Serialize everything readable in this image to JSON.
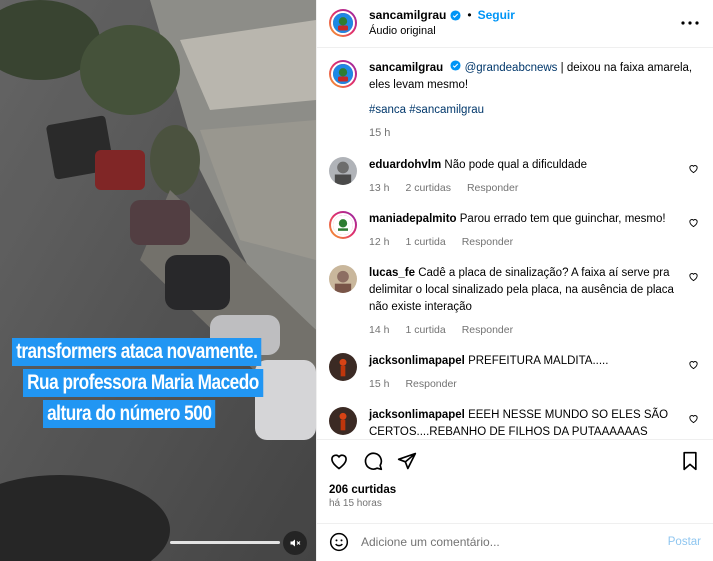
{
  "video": {
    "caption_lines": [
      "transformers ataca novamente.",
      "Rua professora Maria Macedo",
      "altura do número 500"
    ],
    "progress": 0.85,
    "mute_icon": "speaker-muted-icon"
  },
  "post": {
    "username": "sancamilgrau",
    "follow_label": "Seguir",
    "audio_label": "Áudio original",
    "dot": "•",
    "caption": {
      "username": "sancamilgrau",
      "mention": "@grandeabcnews",
      "text": " | deixou na faixa amarela, eles levam mesmo!",
      "hashtags": "#sanca #sancamilgrau",
      "time": "15 h"
    },
    "likes": "206 curtidas",
    "posted_ago": "há 15 horas",
    "comment_placeholder": "Adicione um comentário...",
    "post_label": "Postar"
  },
  "comments": [
    {
      "user": "eduardohvlm",
      "text": "Não pode qual a dificuldade",
      "time": "13 h",
      "likes": "2 curtidas",
      "reply": "Responder"
    },
    {
      "user": "maniadepalmito",
      "text": "Parou errado tem que guinchar, mesmo!",
      "time": "12 h",
      "likes": "1 curtida",
      "reply": "Responder"
    },
    {
      "user": "lucas_fe",
      "text": "Cadê a placa de sinalização? A faixa aí serve pra delimitar o local sinalizado pela placa, na ausência de placa não existe interação",
      "time": "14 h",
      "likes": "1 curtida",
      "reply": "Responder"
    },
    {
      "user": "jacksonlimapapel",
      "text": "PREFEITURA MALDITA.....",
      "time": "15 h",
      "likes": "",
      "reply": "Responder"
    },
    {
      "user": "jacksonlimapapel",
      "text": "EEEH NESSE MUNDO SO ELES SÃO CERTOS....REBANHO DE FILHOS DA PUTAAAAAAS",
      "time": "",
      "likes": "",
      "reply": ""
    }
  ],
  "colors": {
    "accent": "#0095f6",
    "caption_bg": "#2196f3",
    "muted_text": "#737373",
    "link": "#00376b"
  }
}
